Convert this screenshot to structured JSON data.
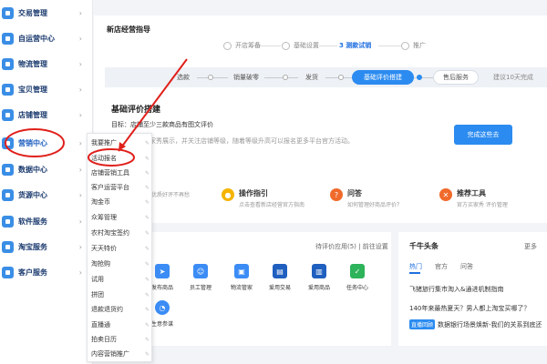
{
  "sidebar": {
    "items": [
      {
        "label": "交易管理"
      },
      {
        "label": "自运营中心"
      },
      {
        "label": "物流管理"
      },
      {
        "label": "宝贝管理"
      },
      {
        "label": "店铺管理"
      },
      {
        "label": "营销中心"
      },
      {
        "label": "数据中心"
      },
      {
        "label": "货源中心"
      },
      {
        "label": "软件服务"
      },
      {
        "label": "淘宝服务"
      },
      {
        "label": "客户服务"
      }
    ]
  },
  "submenu": {
    "items": [
      {
        "label": "我要推广"
      },
      {
        "label": "活动报名"
      },
      {
        "label": "店铺营销工具"
      },
      {
        "label": "客户运营平台"
      },
      {
        "label": "淘金币"
      },
      {
        "label": "众筹管理"
      },
      {
        "label": "农村淘宝签约"
      },
      {
        "label": "天天特价"
      },
      {
        "label": "淘抢购"
      },
      {
        "label": "试用"
      },
      {
        "label": "拼团"
      },
      {
        "label": "退款退货约"
      },
      {
        "label": "直播通"
      },
      {
        "label": "拍卖日历"
      },
      {
        "label": "内容营销推广"
      }
    ]
  },
  "guide": {
    "title": "新店经营指导",
    "steps": [
      "开店筹备",
      "基础设置",
      "3 测款试销",
      "推广"
    ]
  },
  "phases": {
    "items": [
      "选款",
      "销量破零",
      "发货",
      "基础评价搭建",
      "售后服务"
    ],
    "hint": "建议10天完成"
  },
  "task": {
    "title": "基础评价搭建",
    "goal": "目标：店铺至少三款商品有图文评价",
    "desc": "价商品，和买家秀展示，并关注店铺等级，随着等级升高可以报名更多平台官方活动。",
    "button": "完成这些去"
  },
  "resources": [
    {
      "title": "",
      "sub": "么优质好评不再愁"
    },
    {
      "title": "操作指引",
      "sub": "点击查看新店经营官方指南"
    },
    {
      "title": "问答",
      "sub": "如何管理好商品评价？"
    },
    {
      "title": "推荐工具",
      "sub": "官方买家秀  评价管理"
    }
  ],
  "tools": {
    "head": "待评价应用(5)  |  前往设置",
    "items": [
      "发布商品",
      "员工管理",
      "物流管家",
      "爱用交易",
      "爱用商品",
      "任务中心",
      "生意参谋"
    ]
  },
  "news": {
    "title": "千牛头条",
    "more": "更多",
    "tabs": [
      "热门",
      "官方",
      "问答"
    ],
    "lines": [
      "飞猪旅行集市淘入&通进机制指南",
      "140年来最热夏天？男人都上淘宝买哪了？",
      "数据银行场景焕新-我们的关系到底还..."
    ],
    "tag": "直播回顾"
  },
  "colors": {
    "accent": "#2b8bf0",
    "annotation": "#e0201b",
    "sidebar_text": "#1a3a6e"
  },
  "icons": {
    "sidebar": "app-icon",
    "submenu_pin": "pin-icon",
    "chevron": "chevron-right-icon"
  }
}
